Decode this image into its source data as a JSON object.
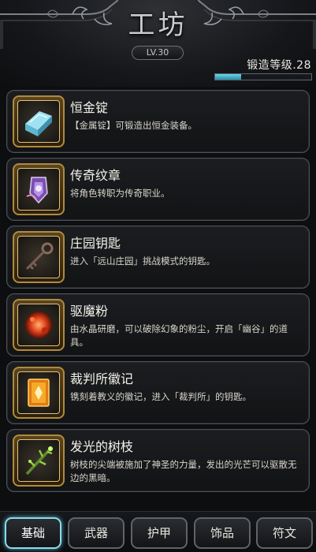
{
  "header": {
    "title": "工坊",
    "level": "LV.30",
    "forge_label": "锻造等级.28",
    "forge_progress": 0.27
  },
  "items": [
    {
      "name": "恒金锭",
      "desc": "【金属锭】可锻造出恒金装备。",
      "icon": "metal-ingot-icon"
    },
    {
      "name": "传奇纹章",
      "desc": "将角色转职为传奇职业。",
      "icon": "legend-emblem-icon"
    },
    {
      "name": "庄园钥匙",
      "desc": "进入「远山庄园」挑战模式的钥匙。",
      "icon": "key-icon"
    },
    {
      "name": "驱魔粉",
      "desc": "由水晶研磨，可以破除幻象的粉尘，开启「幽谷」的道具。",
      "icon": "powder-icon"
    },
    {
      "name": "裁判所徽记",
      "desc": "镌刻着教义的徽记，进入「裁判所」的钥匙。",
      "icon": "badge-icon"
    },
    {
      "name": "发光的树枝",
      "desc": "树枝的尖端被施加了神圣的力量，发出的光芒可以驱散无边的黑暗。",
      "icon": "branch-icon"
    }
  ],
  "tabs": [
    {
      "label": "基础",
      "active": true
    },
    {
      "label": "武器",
      "active": false
    },
    {
      "label": "护甲",
      "active": false
    },
    {
      "label": "饰品",
      "active": false
    },
    {
      "label": "符文",
      "active": false
    }
  ],
  "colors": {
    "accent": "#8fd9e8",
    "gold": "#b28a3b",
    "progress": "#4fc3d6"
  }
}
